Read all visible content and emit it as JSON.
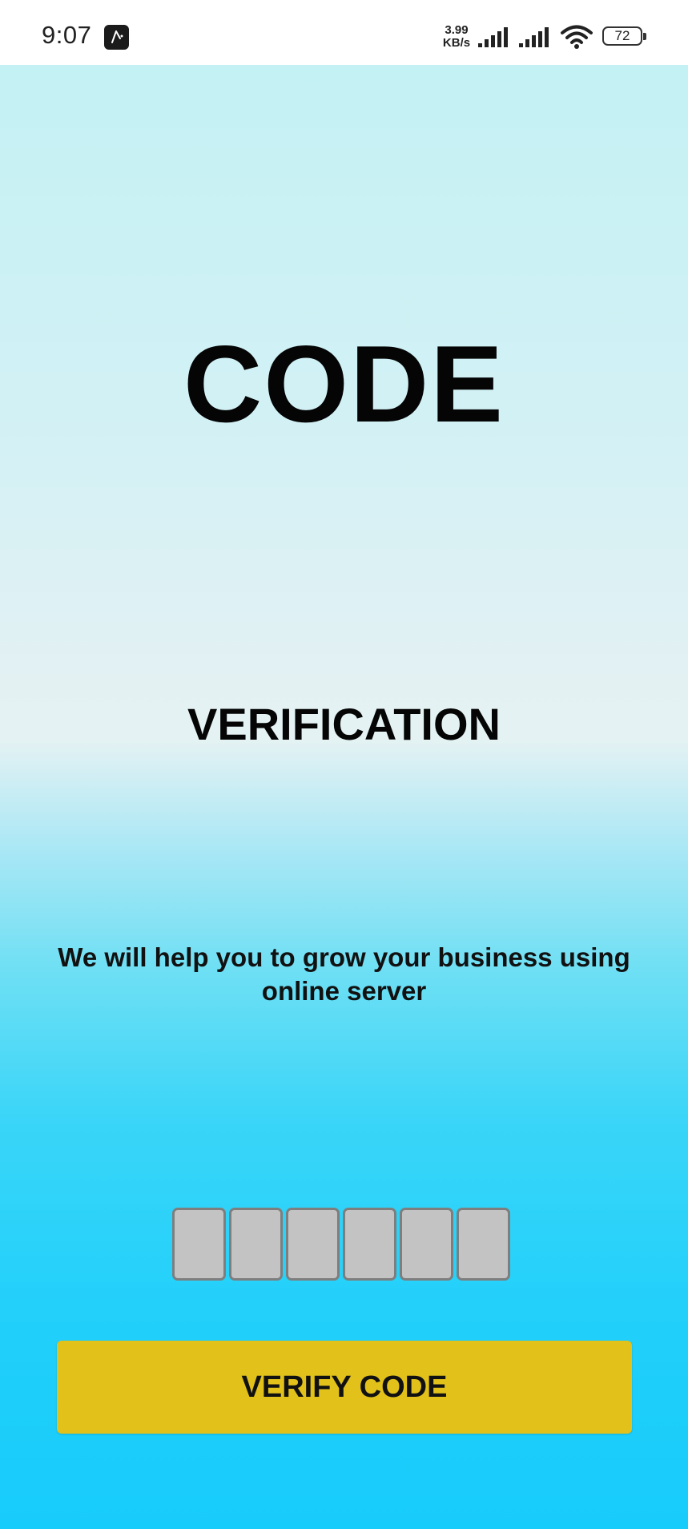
{
  "status_bar": {
    "time": "9:07",
    "net_speed_value": "3.99",
    "net_speed_unit": "KB/s",
    "battery_level": "72"
  },
  "screen": {
    "title": "CODE",
    "subtitle": "VERIFICATION",
    "tagline": "We will help you to grow your business using online server",
    "otp": {
      "digits": [
        "",
        "",
        "",
        "",
        "",
        ""
      ]
    },
    "verify_button_label": "VERIFY CODE"
  },
  "colors": {
    "button": "#e1c11a",
    "otp_box_fill": "#c3c3c3",
    "otp_box_border": "#7e7e7e",
    "gradient_top": "#c4f1f4",
    "gradient_bottom": "#17cbfb"
  },
  "icons": [
    "app-notification-icon",
    "signal-icon",
    "signal-icon",
    "wifi-icon",
    "battery-icon"
  ]
}
